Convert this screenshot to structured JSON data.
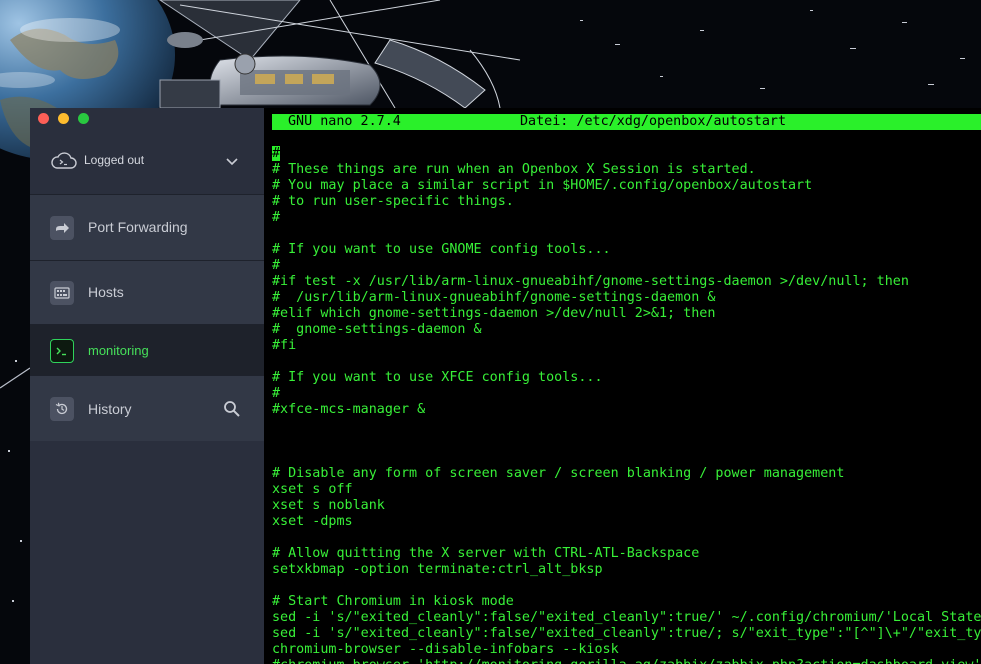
{
  "sidebar": {
    "account": {
      "status": "Logged out"
    },
    "items": [
      {
        "label": "Port Forwarding",
        "icon": "port-forwarding-icon"
      },
      {
        "label": "Hosts",
        "icon": "hosts-icon"
      },
      {
        "label": "monitoring",
        "icon": "terminal-icon",
        "active": true
      },
      {
        "label": "History",
        "icon": "history-icon"
      }
    ],
    "accent": "#46e05a"
  },
  "terminal": {
    "header": {
      "version": "GNU nano 2.7.4",
      "file": "Datei: /etc/xdg/openbox/autostart"
    },
    "text_color": "#38f038",
    "lines": [
      "#",
      "# These things are run when an Openbox X Session is started.",
      "# You may place a similar script in $HOME/.config/openbox/autostart",
      "# to run user-specific things.",
      "#",
      "",
      "# If you want to use GNOME config tools...",
      "#",
      "#if test -x /usr/lib/arm-linux-gnueabihf/gnome-settings-daemon >/dev/null; then",
      "#  /usr/lib/arm-linux-gnueabihf/gnome-settings-daemon &",
      "#elif which gnome-settings-daemon >/dev/null 2>&1; then",
      "#  gnome-settings-daemon &",
      "#fi",
      "",
      "# If you want to use XFCE config tools...",
      "#",
      "#xfce-mcs-manager &",
      "",
      "",
      "",
      "# Disable any form of screen saver / screen blanking / power management",
      "xset s off",
      "xset s noblank",
      "xset -dpms",
      "",
      "# Allow quitting the X server with CTRL-ATL-Backspace",
      "setxkbmap -option terminate:ctrl_alt_bksp",
      "",
      "# Start Chromium in kiosk mode",
      "sed -i 's/\"exited_cleanly\":false/\"exited_cleanly\":true/' ~/.config/chromium/'Local State'",
      "sed -i 's/\"exited_cleanly\":false/\"exited_cleanly\":true/; s/\"exit_type\":\"[^\"]\\+\"/\"exit_type\":\"Normal\"/' ~/.config/chromium/Default/Preferences",
      "chromium-browser --disable-infobars --kiosk",
      "#chromium-browser 'http://monitoring.gorilla.ag/zabbix/zabbix.php?action=dashboard.view'"
    ]
  }
}
